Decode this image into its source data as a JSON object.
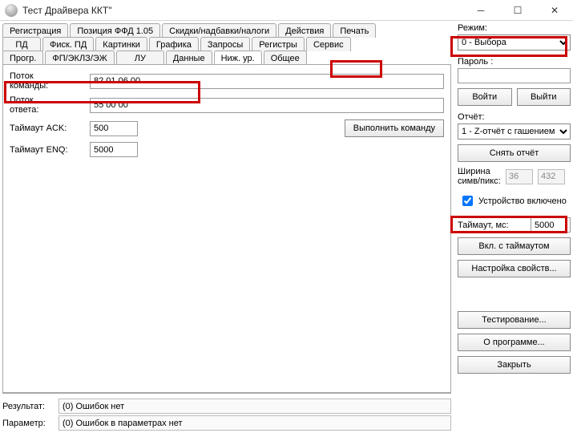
{
  "window": {
    "title": "Тест Драйвера ККТ\""
  },
  "tabs": {
    "row1": [
      "Регистрация",
      "Позиция ФФД 1.05",
      "Скидки/надбавки/налоги",
      "Действия",
      "Печать"
    ],
    "row2": [
      "ПД",
      "Фиск. ПД",
      "Картинки",
      "Графика",
      "Запросы",
      "Регистры",
      "Сервис"
    ],
    "row3": [
      "Прогр.",
      "ФП/ЭКЛЗ/ЭЖ",
      "ЛУ",
      "Данные",
      "Ниж. ур.",
      "Общее"
    ]
  },
  "form": {
    "cmd_stream_label": "Поток\nкоманды:",
    "cmd_stream_value": "82 01 06 00",
    "ans_stream_label": "Поток\nответа:",
    "ans_stream_value": "55 00 00",
    "timeout_ack_label": "Таймаут ACK:",
    "timeout_ack_value": "500",
    "timeout_enq_label": "Таймаут ENQ:",
    "timeout_enq_value": "5000",
    "execute_btn": "Выполнить команду"
  },
  "status": {
    "result_label": "Результат:",
    "result_value": "(0) Ошибок нет",
    "param_label": "Параметр:",
    "param_value": "(0) Ошибок в параметрах нет"
  },
  "side": {
    "mode_label": "Режим:",
    "mode_value": "0 - Выбора",
    "password_label": "Пароль :",
    "password_value": "",
    "login_btn": "Войти",
    "logout_btn": "Выйти",
    "report_label": "Отчёт:",
    "report_value": "1 - Z-отчёт с гашением",
    "take_report_btn": "Снять отчёт",
    "width_label": "Ширина\nсимв/пикс:",
    "width_chars": "36",
    "width_px": "432",
    "device_on_label": "Устройство включено",
    "device_on_checked": true,
    "timeout_label": "Таймаут, мс:",
    "timeout_value": "5000",
    "enable_timeout_btn": "Вкл. с таймаутом",
    "props_btn": "Настройка свойств...",
    "test_btn": "Тестирование...",
    "about_btn": "О программе...",
    "close_btn": "Закрыть"
  }
}
